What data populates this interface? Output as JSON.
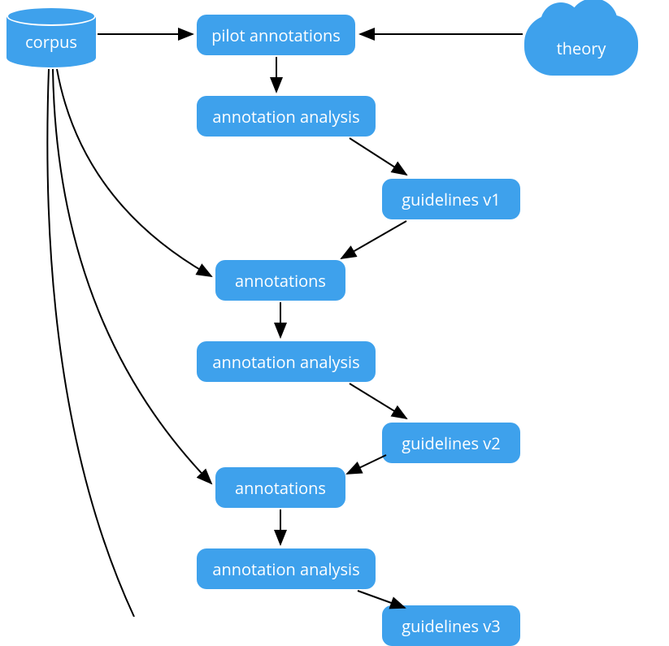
{
  "nodes": {
    "corpus": "corpus",
    "theory": "theory",
    "pilot_annotations": "pilot annotations",
    "annotation_analysis_1": "annotation analysis",
    "guidelines_v1": "guidelines v1",
    "annotations_1": "annotations",
    "annotation_analysis_2": "annotation analysis",
    "guidelines_v2": "guidelines v2",
    "annotations_2": "annotations",
    "annotation_analysis_3": "annotation analysis",
    "guidelines_v3": "guidelines v3"
  }
}
